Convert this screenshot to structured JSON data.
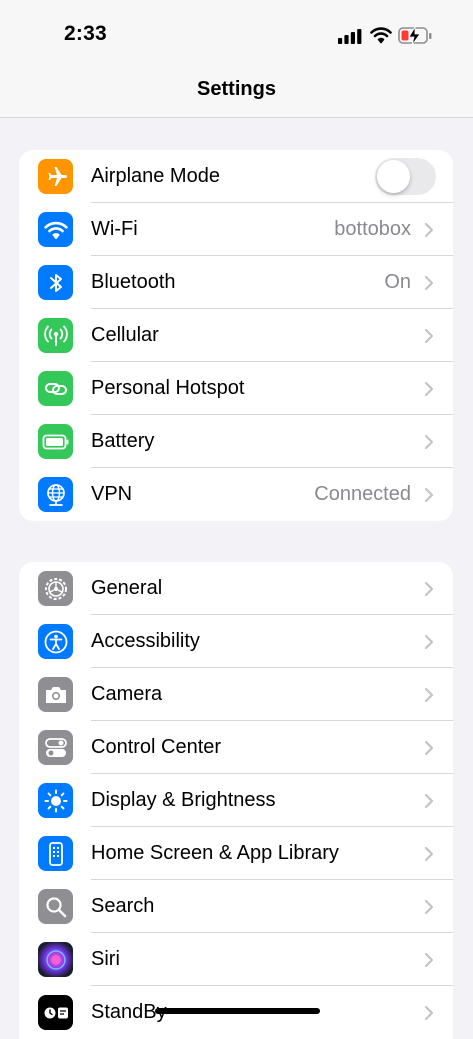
{
  "status_bar": {
    "time": "2:33"
  },
  "nav": {
    "title": "Settings"
  },
  "group1": [
    {
      "label": "Airplane Mode",
      "icon": "airplane-icon",
      "color": "#ff9500",
      "toggle": false
    },
    {
      "label": "Wi-Fi",
      "value": "bottobox",
      "icon": "wifi-icon",
      "color": "#007aff"
    },
    {
      "label": "Bluetooth",
      "value": "On",
      "icon": "bluetooth-icon",
      "color": "#007aff"
    },
    {
      "label": "Cellular",
      "icon": "cellular-antenna-icon",
      "color": "#34c759"
    },
    {
      "label": "Personal Hotspot",
      "icon": "hotspot-link-icon",
      "color": "#34c759"
    },
    {
      "label": "Battery",
      "icon": "battery-icon",
      "color": "#34c759"
    },
    {
      "label": "VPN",
      "value": "Connected",
      "icon": "vpn-globe-icon",
      "color": "#007aff"
    }
  ],
  "group2": [
    {
      "label": "General",
      "icon": "gear-icon",
      "color": "#8e8e93"
    },
    {
      "label": "Accessibility",
      "icon": "accessibility-icon",
      "color": "#007aff"
    },
    {
      "label": "Camera",
      "icon": "camera-icon",
      "color": "#8e8e93"
    },
    {
      "label": "Control Center",
      "icon": "control-center-icon",
      "color": "#8e8e93"
    },
    {
      "label": "Display & Brightness",
      "icon": "sun-icon",
      "color": "#007aff"
    },
    {
      "label": "Home Screen & App Library",
      "icon": "home-screen-icon",
      "color": "#007aff"
    },
    {
      "label": "Search",
      "icon": "search-icon",
      "color": "#8e8e93"
    },
    {
      "label": "Siri",
      "icon": "siri-icon",
      "color": "#2a1b3d"
    },
    {
      "label": "StandBy",
      "icon": "standby-icon",
      "color": "#000000"
    }
  ]
}
